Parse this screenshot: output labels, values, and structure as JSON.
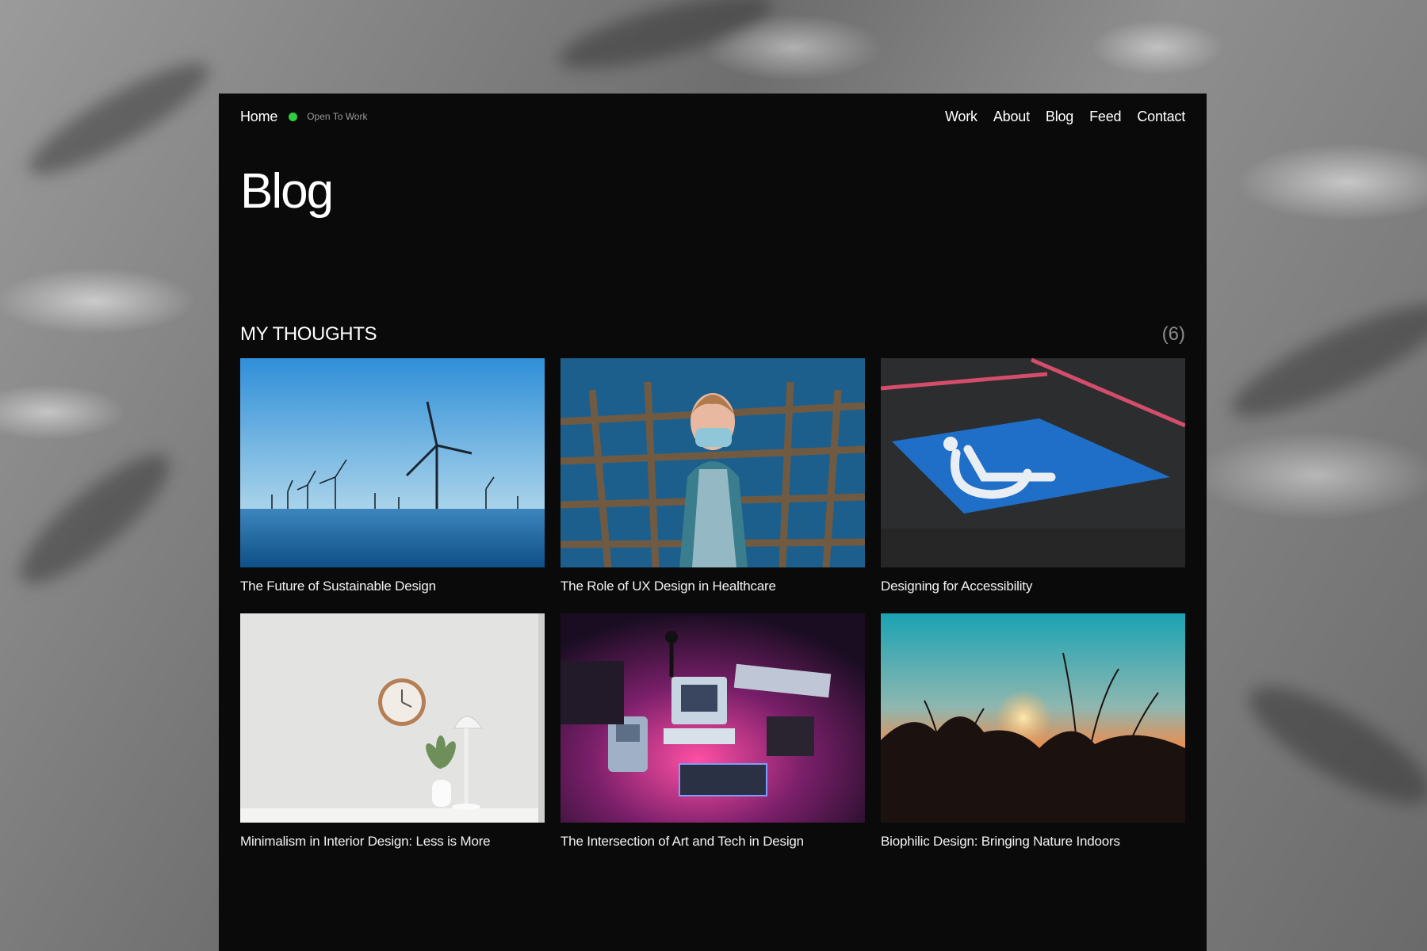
{
  "nav": {
    "home": "Home",
    "status": "Open To Work",
    "status_color": "#2ecc40",
    "links": [
      "Work",
      "About",
      "Blog",
      "Feed",
      "Contact"
    ]
  },
  "page": {
    "title": "Blog"
  },
  "section": {
    "title": "MY THOUGHTS",
    "count": "(6)"
  },
  "posts": [
    {
      "title": "The Future of Sustainable Design",
      "image": "offshore-wind-turbines"
    },
    {
      "title": "The Role of UX Design in Healthcare",
      "image": "nurse-with-mask"
    },
    {
      "title": "Designing for Accessibility",
      "image": "wheelchair-parking-symbol"
    },
    {
      "title": "Minimalism in Interior Design: Less is More",
      "image": "clock-and-plant-on-table"
    },
    {
      "title": "The Intersection of Art and Tech in Design",
      "image": "retro-computers-neon"
    },
    {
      "title": "Biophilic Design: Bringing Nature Indoors",
      "image": "sunset-through-plants"
    }
  ]
}
